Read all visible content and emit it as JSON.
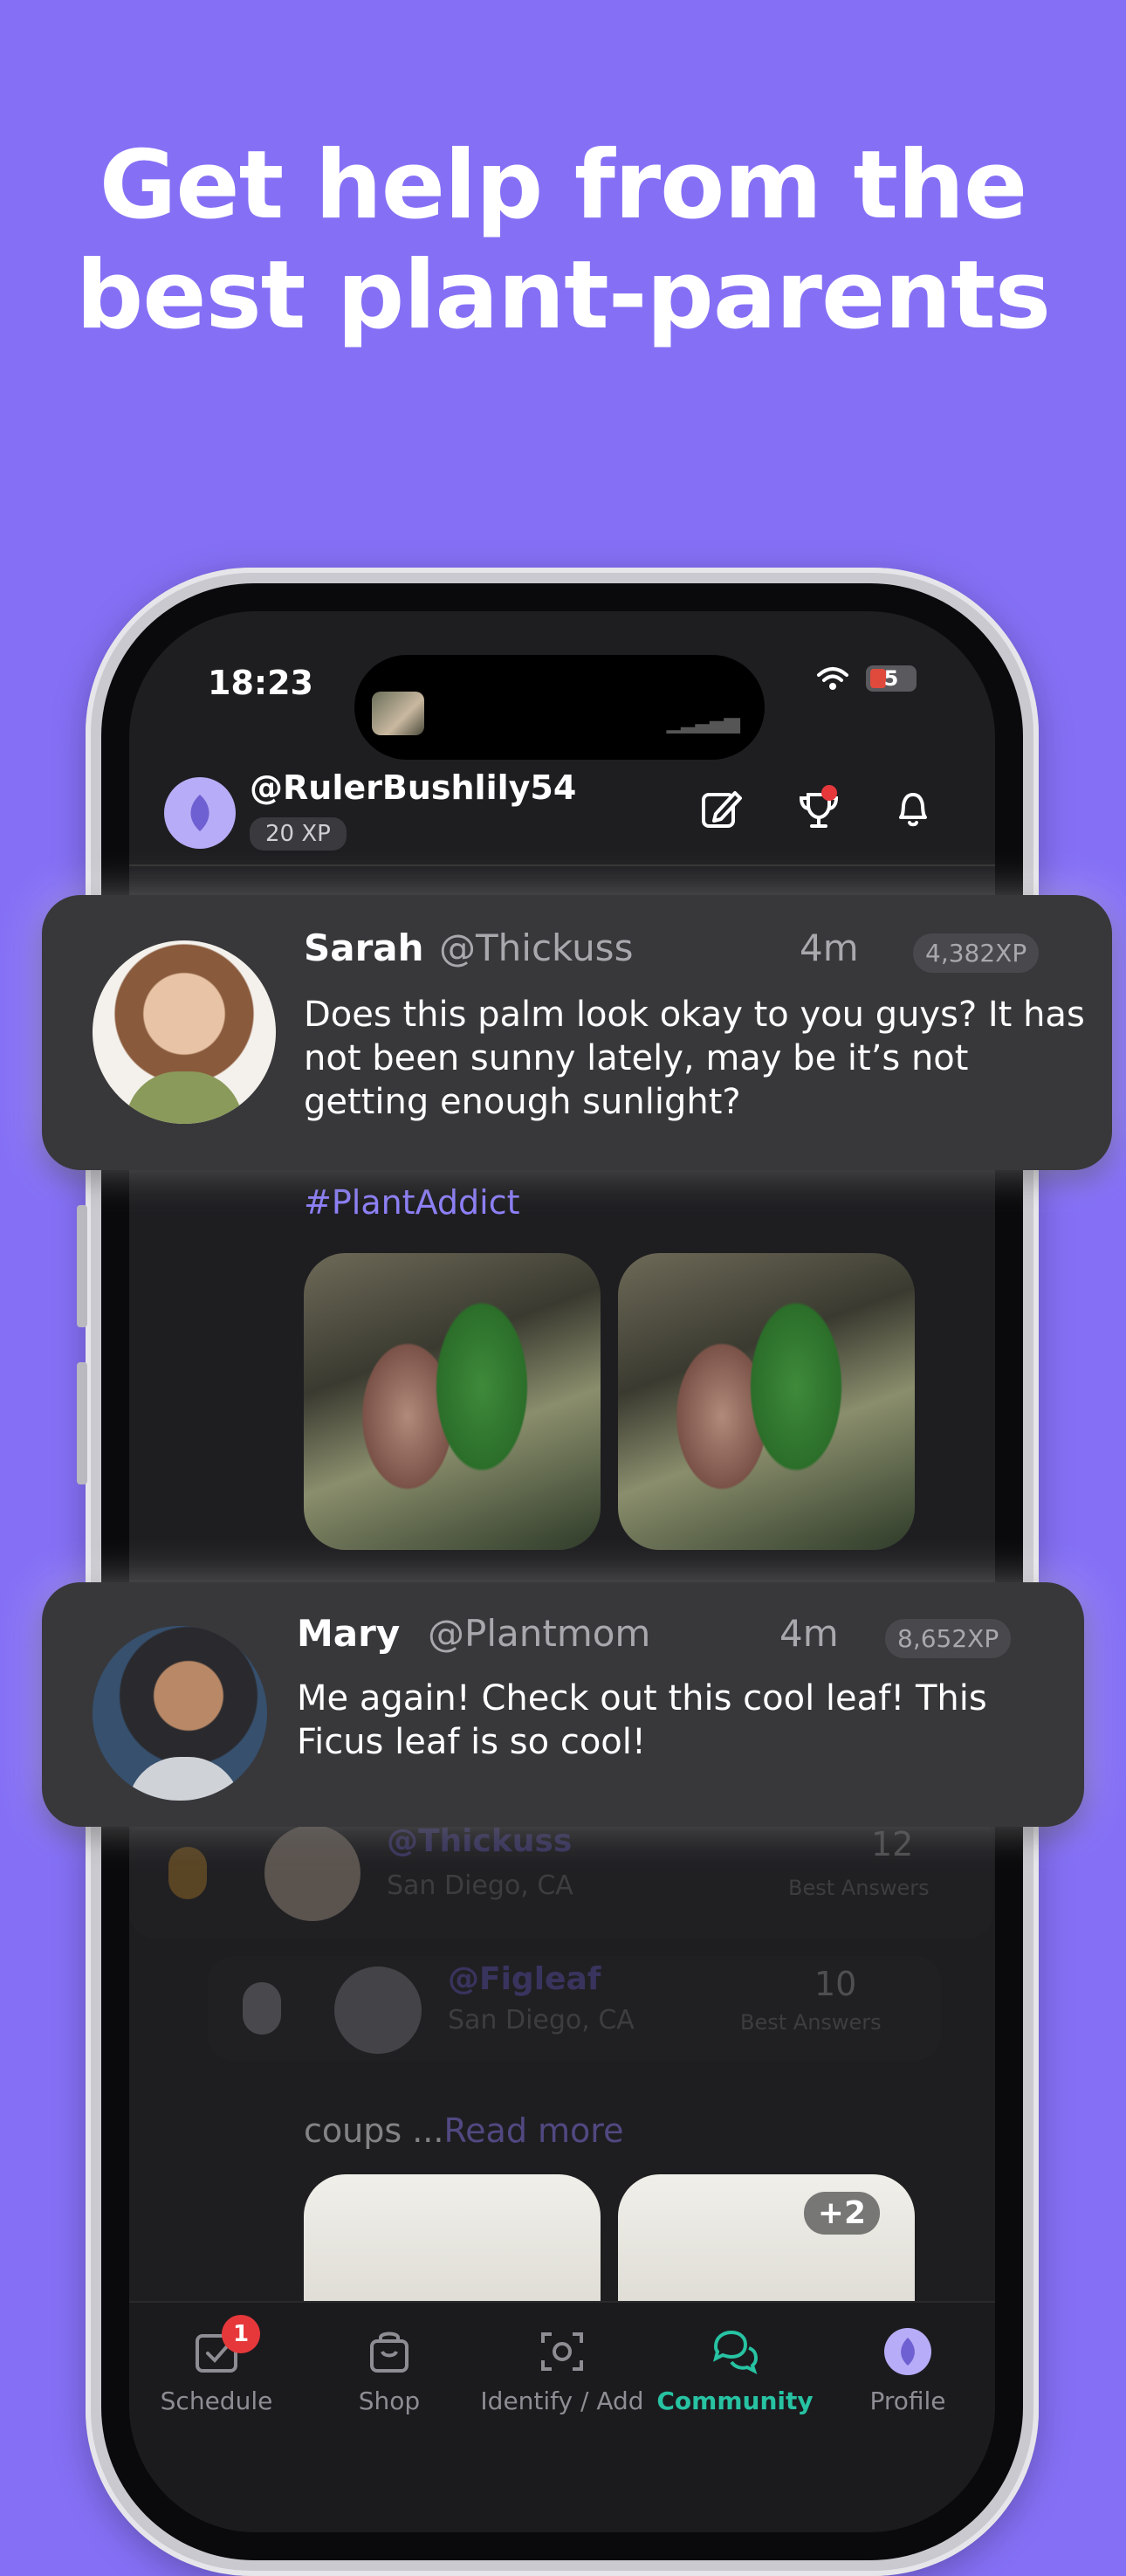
{
  "headline": {
    "line1": "Get help from the",
    "line2": "best plant-parents"
  },
  "status_bar": {
    "time": "18:23",
    "battery": "5"
  },
  "header": {
    "username": "@RulerBushlily54",
    "xp": "20 XP"
  },
  "feed": {
    "hashtag": "#PlantAddict",
    "read_more_prefix": "coups ...",
    "read_more": "Read more",
    "photo_more": "+2"
  },
  "leaderboard": [
    {
      "handle": "@Thickuss",
      "location": "San Diego, CA",
      "count": "12",
      "label": "Best Answers"
    },
    {
      "handle": "@Figleaf",
      "location": "San Diego, CA",
      "count": "10",
      "label": "Best Answers"
    }
  ],
  "cards": [
    {
      "name": "Sarah",
      "handle": "@Thickuss",
      "time": "4m",
      "xp": "4,382XP",
      "body": "Does this palm look okay to you guys? It has not been sunny lately, may be it’s not getting enough sunlight?"
    },
    {
      "name": "Mary",
      "handle": "@Plantmom",
      "time": "4m",
      "xp": "8,652XP",
      "body": "Me again! Check out this cool leaf! This Ficus leaf is so cool!"
    }
  ],
  "nav": {
    "schedule": "Schedule",
    "schedule_badge": "1",
    "shop": "Shop",
    "identify": "Identify / Add",
    "community": "Community",
    "profile": "Profile"
  },
  "colors": {
    "background": "#8570f5",
    "accent": "#27c3a2",
    "brand": "#8d7ff6"
  }
}
